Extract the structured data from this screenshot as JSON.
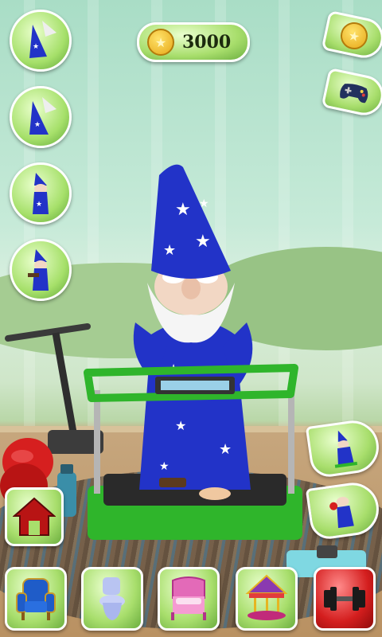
{
  "hud": {
    "coin_count": "3000"
  },
  "left_outfit_buttons": [
    {
      "name": "wizard-outfit-1"
    },
    {
      "name": "wizard-outfit-2"
    },
    {
      "name": "wizard-outfit-3"
    },
    {
      "name": "wizard-outfit-4"
    }
  ],
  "right_buttons": [
    "coin-shop",
    "mini-games"
  ],
  "exercise_buttons": [
    "exercise-treadmill",
    "exercise-boxing"
  ],
  "bottom_bar": [
    {
      "room": "living-room",
      "icon": "armchair-icon"
    },
    {
      "room": "bathroom",
      "icon": "toilet-icon"
    },
    {
      "room": "bedroom",
      "icon": "bed-icon"
    },
    {
      "room": "playroom",
      "icon": "carousel-icon"
    },
    {
      "room": "gym",
      "icon": "dumbbell-icon",
      "active": true
    }
  ],
  "colors": {
    "button_green": "#a8de6c",
    "active_red": "#d41e1e",
    "wizard_blue": "#2233c8",
    "treadmill_green": "#2fb52b"
  }
}
